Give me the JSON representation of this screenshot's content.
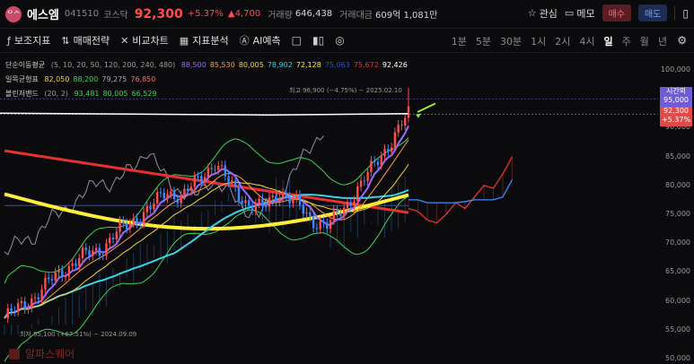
{
  "header": {
    "logo_text": "ᄋᄉ",
    "name": "에스엠",
    "code": "041510",
    "market": "코스닥",
    "price": "92,300",
    "change_pct": "+5.37%",
    "change_abs": "▲4,700",
    "volume_label": "거래량",
    "volume": "646,438",
    "amount_label": "거래대금",
    "amount": "609억 1,081만",
    "interest": "관심",
    "memo": "메모",
    "buy": "매수",
    "sell": "매도"
  },
  "toolbar": {
    "indicators": "보조지표",
    "strategy": "매매전략",
    "compare": "비교차트",
    "analysis": "지표분석",
    "ai_predict": "AI예측",
    "periods": [
      "1분",
      "5분",
      "30분",
      "1시",
      "2시",
      "4시",
      "일",
      "주",
      "월",
      "년"
    ],
    "active_period": "일"
  },
  "legend": {
    "ma_label": "단순이동평균",
    "ma_params": "(5, 10, 20, 50, 120, 200, 240, 480)",
    "ma_values": [
      {
        "v": "88,500",
        "color": "#9b6bff"
      },
      {
        "v": "85,530",
        "color": "#ff9b3d"
      },
      {
        "v": "80,005",
        "color": "#f5d33a"
      },
      {
        "v": "78,902",
        "color": "#38d3e6"
      },
      {
        "v": "72,128",
        "color": "#ffef3a"
      },
      {
        "v": "75,063",
        "color": "#2850d8"
      },
      {
        "v": "75,672",
        "color": "#e83030"
      },
      {
        "v": "92,426",
        "color": "#ffffff"
      }
    ],
    "ichimoku_label": "일목균형표",
    "ichimoku_values": [
      {
        "v": "82,050",
        "color": "#f5d33a"
      },
      {
        "v": "88,200",
        "color": "#3ad35a"
      },
      {
        "v": "79,275",
        "color": "#aaaaaa"
      },
      {
        "v": "76,850",
        "color": "#ff6b6b"
      }
    ],
    "bb_label": "볼린저밴드",
    "bb_params": "(20, 2)",
    "bb_values": [
      {
        "v": "93,481",
        "color": "#3ad35a"
      },
      {
        "v": "80,005",
        "color": "#3ad35a"
      },
      {
        "v": "66,529",
        "color": "#3ad35a"
      }
    ]
  },
  "chart_data": {
    "type": "line",
    "series_close_approx": [
      57000,
      59000,
      61000,
      64000,
      66000,
      68000,
      69000,
      72000,
      74000,
      76000,
      79000,
      78000,
      81000,
      84000,
      80000,
      77000,
      76000,
      79000,
      77000,
      74000,
      73000,
      76000,
      80000,
      84000,
      88000,
      92300
    ],
    "high_annotation": "최고 96,900 (−4.75%) − 2025.02.10",
    "low_annotation": "최저 55,100 (+67.51%) − 2024.09.09",
    "y_ticks": [
      "100,000",
      "95,000",
      "90,000",
      "85,000",
      "80,000",
      "75,000",
      "70,000",
      "65,000",
      "60,000",
      "55,000",
      "50,000"
    ],
    "ylim": [
      50000,
      100000
    ]
  },
  "axis_tags": {
    "timer_label": "시간외",
    "timer_price": "95,000",
    "current_price": "92,300",
    "current_pct": "+5.37%"
  },
  "watermark": "알파스퀘어"
}
